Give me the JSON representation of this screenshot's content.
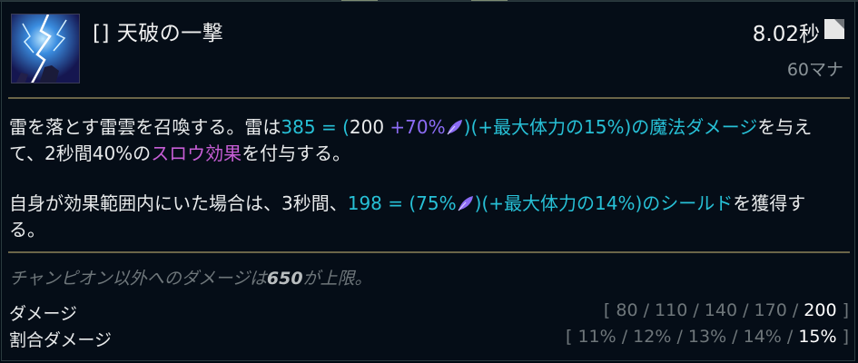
{
  "ability": {
    "title": "[] 天破の一撃",
    "cooldown": "8.02秒",
    "cost": "60マナ"
  },
  "description": {
    "p1": {
      "a": "雷を落とす雷雲を召喚する。雷は",
      "dmg_total": "385 = ",
      "paren_open": "(",
      "base": "200",
      "ap_ratio": " +70%",
      "close_paren": ")",
      "hp_ratio": "(+最大体力の15%)",
      "dmg_type": "の魔法ダメージ",
      "b": "を与え",
      "c": "て、2秒間40%の",
      "slow": "スロウ効果",
      "d": "を付与する。"
    },
    "p2": {
      "a": "自身が効果範囲内にいた場合は、3秒間、",
      "shield_total": "198 = (75%",
      "close_paren": ")",
      "hp_ratio": "(+最大体力の14%)",
      "shield": "のシールド",
      "b": "を獲得す",
      "c": "る。"
    }
  },
  "note": {
    "a": "チャンピオン以外へのダメージは",
    "cap": "650",
    "b": "が上限。"
  },
  "stats": [
    {
      "label": "ダメージ",
      "open": "[ ",
      "values": "80 / 110 / 140 / 170 / ",
      "current": "200",
      "close": " ]"
    },
    {
      "label": "割合ダメージ",
      "open": "[ ",
      "values": "11% / 12% / 13% / 14% / ",
      "current": "15%",
      "close": " ]"
    }
  ],
  "colors": {
    "background": "#010a13",
    "scaling_cyan": "#27c0d6",
    "ap_purple": "#8c6cf5",
    "slow_magenta": "#c75ed6",
    "divider_gold": "#6b6548"
  },
  "icons": {
    "ability": "lightning-storm-icon",
    "cooldown": "cooldown-icon",
    "ap": "ability-power-icon"
  }
}
